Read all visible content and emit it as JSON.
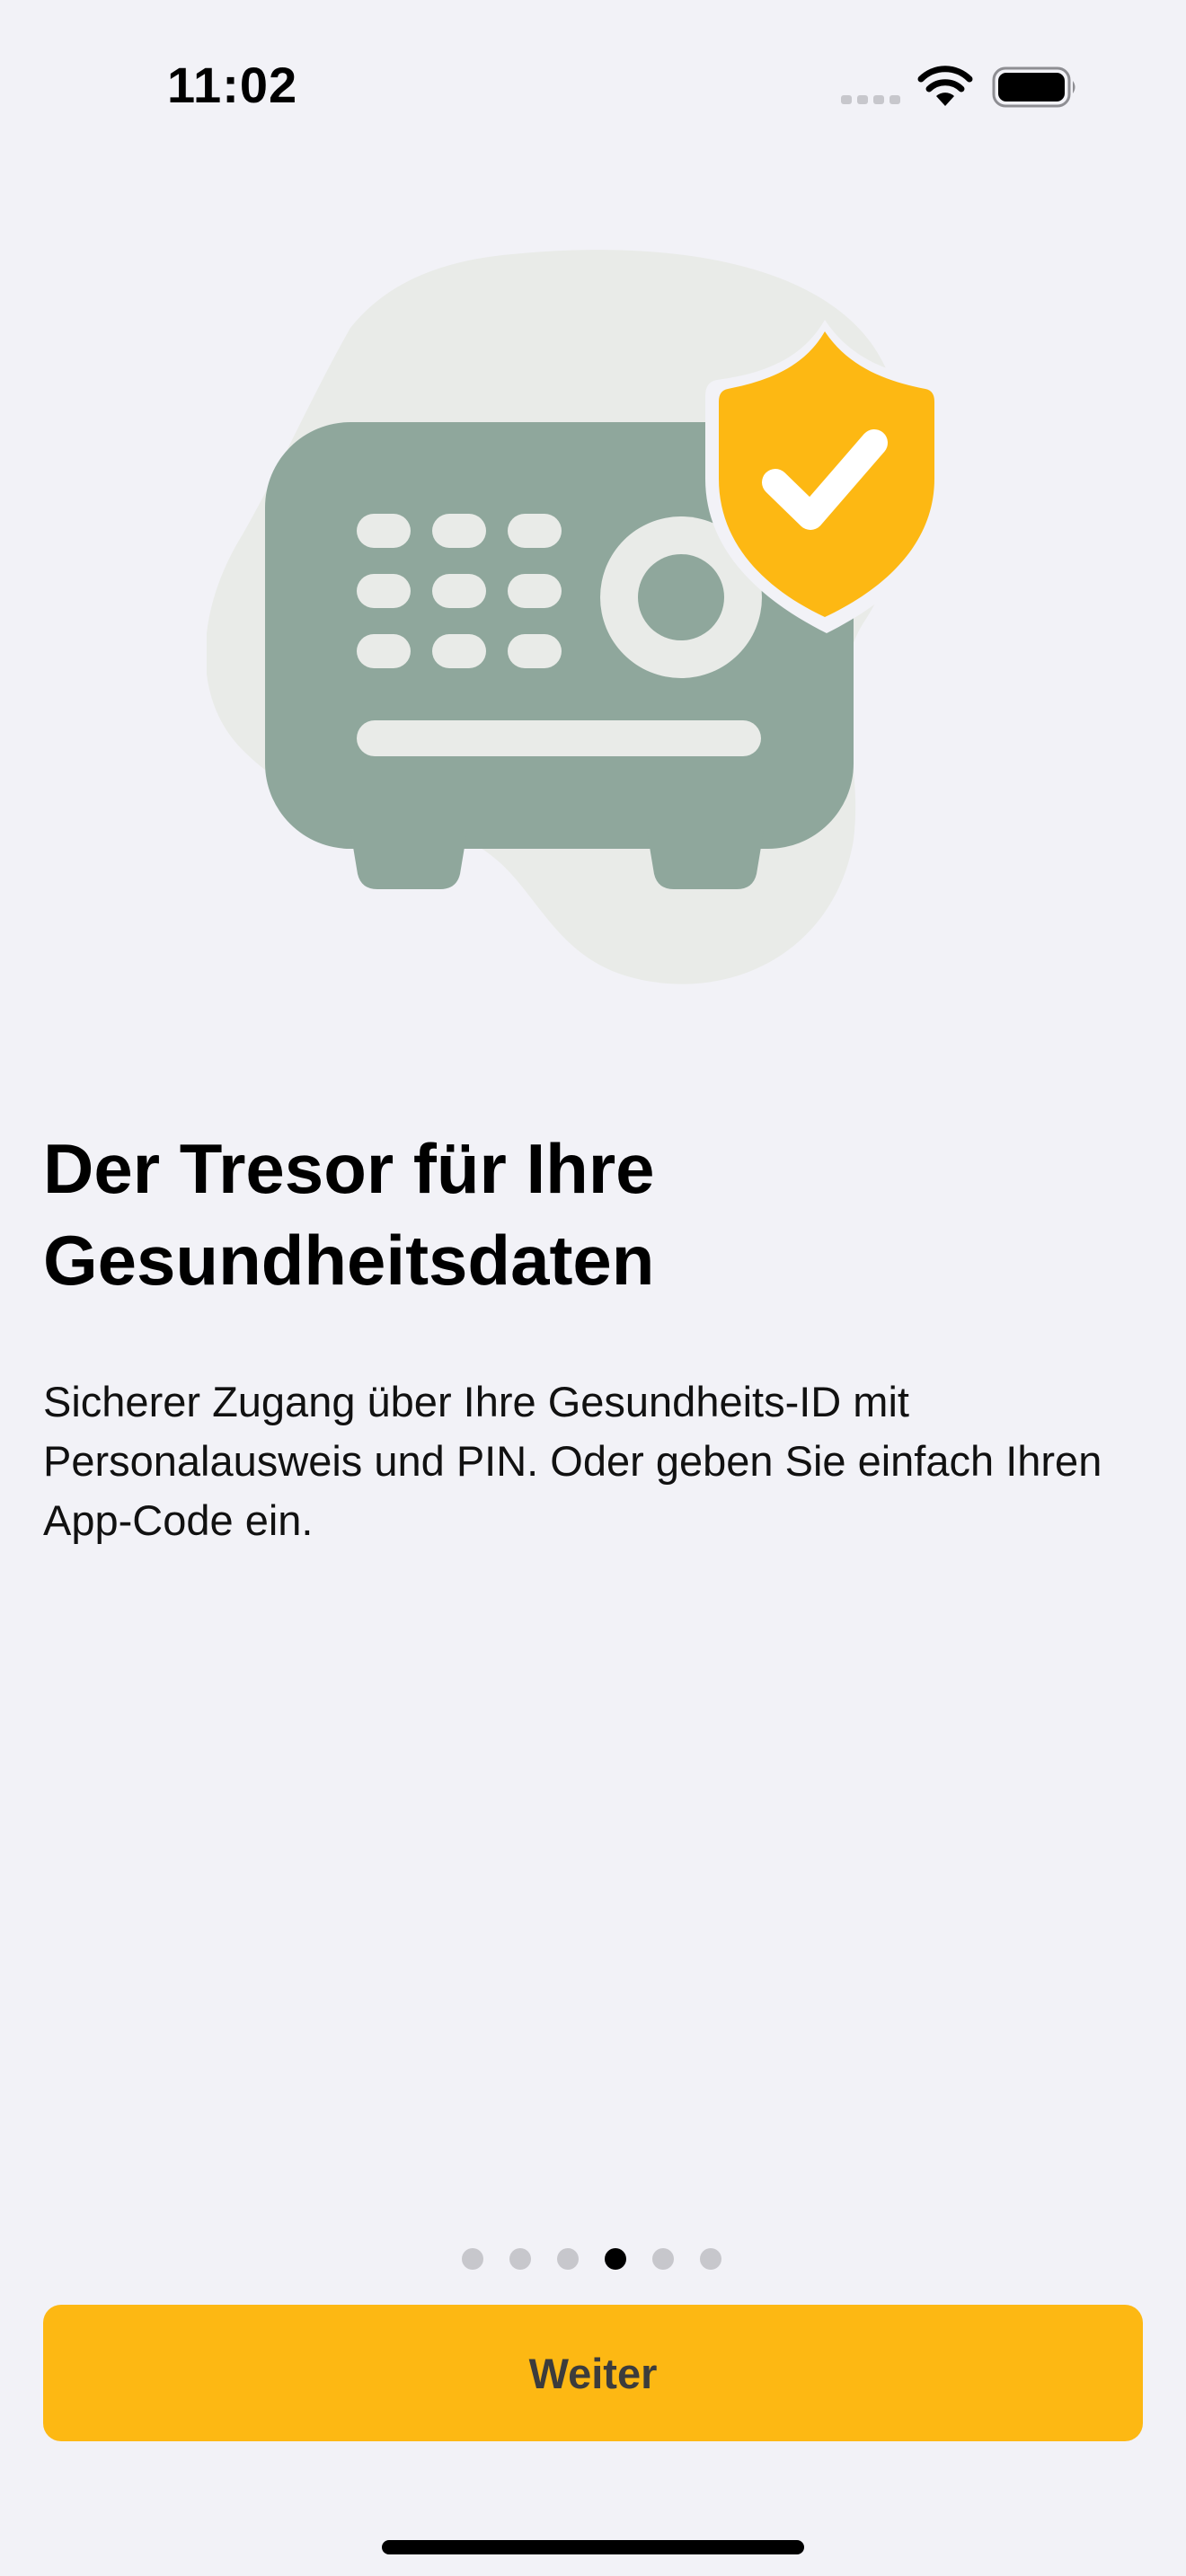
{
  "status_bar": {
    "time": "11:02",
    "signal_icon": "cellular-signal-icon",
    "wifi_icon": "wifi-icon",
    "battery_icon": "battery-icon"
  },
  "illustration": {
    "description_icon": "safe-shield-check-icon",
    "colors": {
      "blob": "#e9ebe8",
      "safe": "#8fa79c",
      "safe_details": "#e9ebe8",
      "shield": "#fdb813",
      "check": "#ffffff"
    }
  },
  "content": {
    "title": "Der Tresor für Ihre Gesundheitsdaten",
    "body": "Sicherer Zugang über Ihre Gesundheits-ID mit Personalausweis und PIN. Oder geben Sie einfach Ihren App-Code ein."
  },
  "pagination": {
    "total_pages": 6,
    "current_page": 4
  },
  "actions": {
    "primary_label": "Weiter"
  },
  "colors": {
    "background": "#f2f2f7",
    "accent": "#fdb813",
    "button_text": "#3c3c3c",
    "dot_inactive": "#c7c7cc",
    "dot_active": "#000000"
  }
}
